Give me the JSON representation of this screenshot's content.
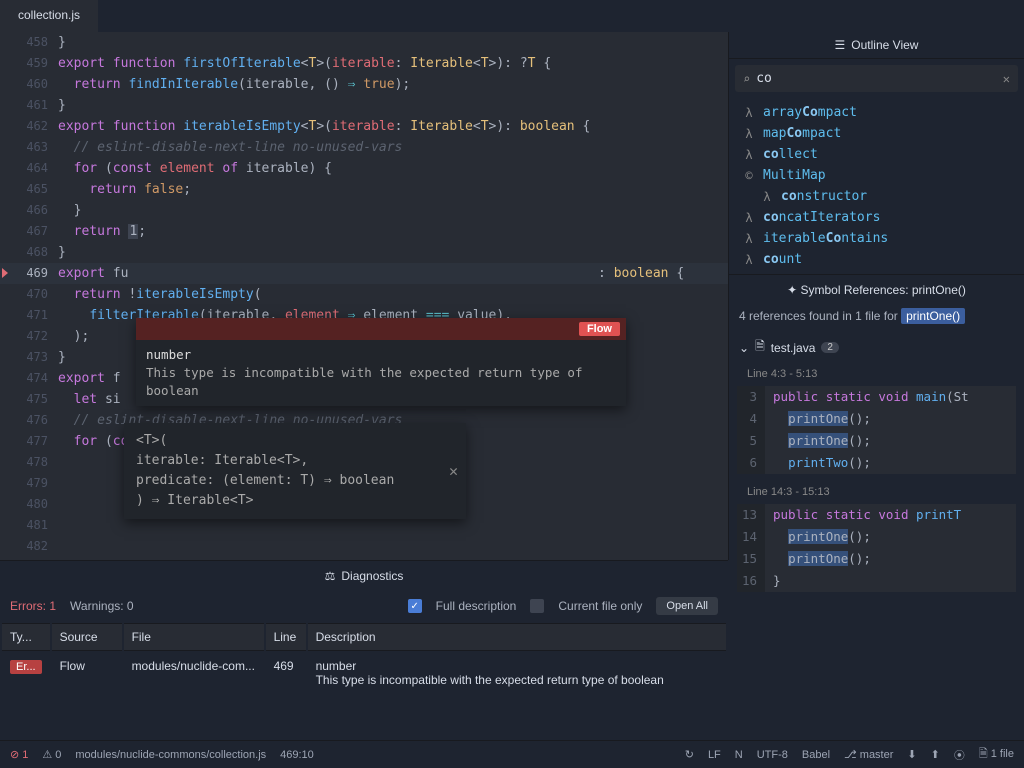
{
  "tabs": {
    "editor_file": "collection.js",
    "outline_title": "Outline View"
  },
  "outline": {
    "search_value": "co",
    "items": [
      {
        "icon": "λ",
        "pre": "array",
        "bold": "Co",
        "post": "mpact",
        "indent": false
      },
      {
        "icon": "λ",
        "pre": "map",
        "bold": "Co",
        "post": "mpact",
        "indent": false
      },
      {
        "icon": "λ",
        "pre": "",
        "bold": "co",
        "post": "llect",
        "indent": false
      },
      {
        "icon": "©",
        "pre": "MultiMap",
        "bold": "",
        "post": "",
        "indent": false
      },
      {
        "icon": "λ",
        "pre": "",
        "bold": "co",
        "post": "nstructor",
        "indent": true
      },
      {
        "icon": "λ",
        "pre": "",
        "bold": "co",
        "post": "ncatIterators",
        "indent": false
      },
      {
        "icon": "λ",
        "pre": "iterable",
        "bold": "Co",
        "post": "ntains",
        "indent": false
      },
      {
        "icon": "λ",
        "pre": "",
        "bold": "co",
        "post": "unt",
        "indent": false
      }
    ]
  },
  "gutter": {
    "start": 458,
    "end": 482,
    "highlight": 469,
    "error_line": 469
  },
  "flyover": {
    "badge": "Flow",
    "title": "number",
    "body": "This type is incompatible with the expected return type of boolean"
  },
  "hint": {
    "l1": "<T>(",
    "l2": "  iterable: Iterable<T>,",
    "l3": "  predicate: (element: T) ⇒ boolean",
    "l4": ") ⇒ Iterable<T>"
  },
  "refs": {
    "title": "Symbol References: printOne()",
    "summary_pre": "4 references found in 1 file for ",
    "summary_sym": "printOne()",
    "file": "test.java",
    "count": "2",
    "ranges": [
      {
        "label": "Line 4:3 - 5:13",
        "lines": [
          {
            "n": "3",
            "txt": [
              "public ",
              "static ",
              "void ",
              "main",
              "(St"
            ],
            "hl": []
          },
          {
            "n": "4",
            "txt": [
              "  ",
              "printOne",
              "();"
            ],
            "hl": [
              1
            ]
          },
          {
            "n": "5",
            "txt": [
              "  ",
              "printOne",
              "();"
            ],
            "hl": [
              1
            ]
          },
          {
            "n": "6",
            "txt": [
              "  ",
              "printTwo",
              "();"
            ],
            "hl": []
          }
        ]
      },
      {
        "label": "Line 14:3 - 15:13",
        "lines": [
          {
            "n": "13",
            "txt": [
              "public ",
              "static ",
              "void ",
              "printT"
            ],
            "hl": []
          },
          {
            "n": "14",
            "txt": [
              "  ",
              "printOne",
              "();"
            ],
            "hl": [
              1
            ]
          },
          {
            "n": "15",
            "txt": [
              "  ",
              "printOne",
              "();"
            ],
            "hl": [
              1
            ]
          },
          {
            "n": "16",
            "txt": [
              "}"
            ],
            "hl": []
          }
        ]
      }
    ]
  },
  "diagnostics": {
    "title": "Diagnostics",
    "errors_label": "Errors: 1",
    "warnings_label": "Warnings: 0",
    "fulldesc": "Full description",
    "curfile": "Current file only",
    "openall": "Open All",
    "cols": {
      "ty": "Ty...",
      "source": "Source",
      "file": "File",
      "line": "Line",
      "desc": "Description"
    },
    "row": {
      "sev": "Er...",
      "source": "Flow",
      "file": "modules/nuclide-com...",
      "line": "469",
      "d1": "number",
      "d2": "This type is incompatible with the expected return type of boolean"
    }
  },
  "status": {
    "err": "1",
    "warn": "0",
    "path": "modules/nuclide-commons/collection.js",
    "pos": "469:10",
    "lf": "LF",
    "n": "N",
    "enc": "UTF-8",
    "lang": "Babel",
    "branch": "master",
    "files": "1 file"
  }
}
